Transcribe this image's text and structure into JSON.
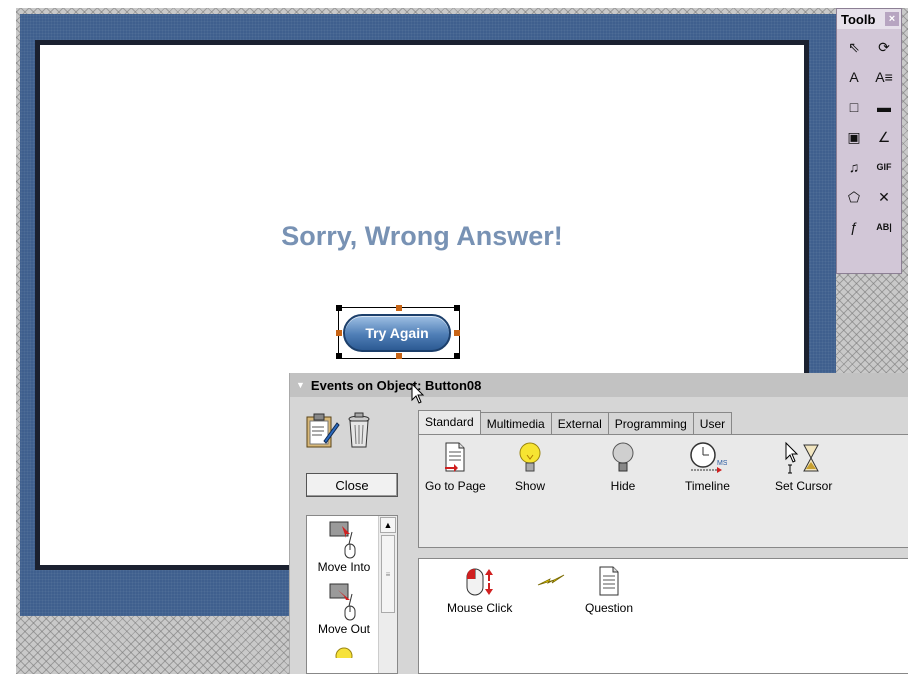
{
  "slide": {
    "headline": "Sorry, Wrong Answer!",
    "button_label": "Try Again"
  },
  "toolbox": {
    "title": "Toolb",
    "close": "×",
    "tools": [
      {
        "name": "pointer-tool",
        "glyph": "⇖"
      },
      {
        "name": "rotate-tool",
        "glyph": "⟳"
      },
      {
        "name": "text-tool",
        "glyph": "A"
      },
      {
        "name": "text-field-tool",
        "glyph": "A≡"
      },
      {
        "name": "rectangle-tool",
        "glyph": "□"
      },
      {
        "name": "button-tool",
        "glyph": "▬"
      },
      {
        "name": "image-tool",
        "glyph": "▣"
      },
      {
        "name": "line-tool",
        "glyph": "∠"
      },
      {
        "name": "media-tool",
        "glyph": "♫"
      },
      {
        "name": "gif-tool",
        "glyph": "GIF"
      },
      {
        "name": "shape-tool",
        "glyph": "⬠"
      },
      {
        "name": "path-tool",
        "glyph": "✕"
      },
      {
        "name": "flash-tool",
        "glyph": "ƒ"
      },
      {
        "name": "input-field-tool",
        "glyph": "AB|"
      }
    ]
  },
  "events_panel": {
    "title": "Events on Object: Button08",
    "close_button": "Close",
    "left_events": [
      {
        "label": "Move Into",
        "icon": "mouse-move-into-icon"
      },
      {
        "label": "Move Out",
        "icon": "mouse-move-out-icon"
      }
    ],
    "tabs": [
      "Standard",
      "Multimedia",
      "External",
      "Programming",
      "User"
    ],
    "active_tab": "Standard",
    "actions": [
      {
        "label": "Go to Page",
        "icon": "page-icon"
      },
      {
        "label": "Show",
        "icon": "lightbulb-on-icon"
      },
      {
        "label": "Hide",
        "icon": "lightbulb-off-icon"
      },
      {
        "label": "Timeline",
        "icon": "clock-icon"
      },
      {
        "label": "Set Cursor",
        "icon": "cursor-hourglass-icon"
      }
    ],
    "assigned": [
      {
        "label": "Mouse Click",
        "icon": "mouse-click-icon"
      },
      {
        "label": "Question",
        "icon": "question-page-icon"
      }
    ],
    "colors": {
      "panel": "#d6d6d6",
      "title": "#c2c2c2",
      "slide_frame": "#3f5f8e",
      "headline": "#7892b4"
    }
  }
}
